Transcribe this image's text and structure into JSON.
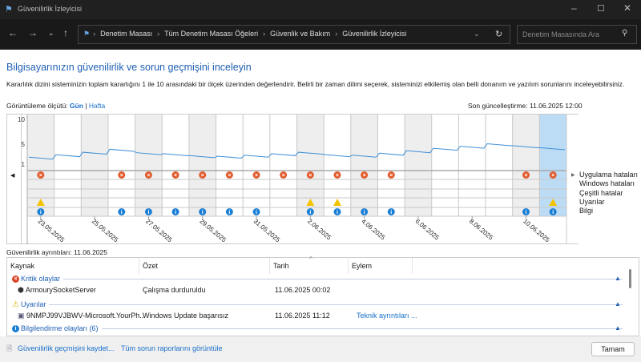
{
  "window": {
    "title": "Güvenilirlik İzleyicisi"
  },
  "address": {
    "crumbs": [
      "Denetim Masası",
      "Tüm Denetim Masası Öğeleri",
      "Güvenlik ve Bakım",
      "Güvenilirlik İzleyicisi"
    ],
    "search_placeholder": "Denetim Masasında Ara"
  },
  "main": {
    "heading": "Bilgisayarınızın güvenilirlik ve sorun geçmişini inceleyin",
    "description": "Kararlılık dizini sisteminizin toplam kararlığını 1 ile 10 arasındaki bir ölçek üzerinden değerlendirir. Belirli bir zaman dilimi seçerek, sisteminizi etkilemiş olan belli donanım ve yazılım sorunlarını inceleyebilirsiniz.",
    "view_label": "Görüntüleme ölçütü:",
    "view_day": "Gün",
    "view_sep": "|",
    "view_week": "Hafta",
    "last_updated": "Son güncelleştirme: 11.06.2025 12:00"
  },
  "chart_data": {
    "type": "line",
    "ylim": [
      1,
      10
    ],
    "yticks": [
      "10",
      "5",
      "1"
    ],
    "dates": [
      "23.05.2025",
      "24.05.2025",
      "25.05.2025",
      "26.05.2025",
      "27.05.2025",
      "28.05.2025",
      "29.05.2025",
      "30.05.2025",
      "31.05.2025",
      "1.06.2025",
      "2.06.2025",
      "3.06.2025",
      "4.06.2025",
      "5.06.2025",
      "6.06.2025",
      "7.06.2025",
      "8.06.2025",
      "9.06.2025",
      "10.06.2025",
      "11.06.2025"
    ],
    "date_labels": [
      "23.05.2025",
      "25.05.2025",
      "27.05.2025",
      "29.05.2025",
      "31.05.2025",
      "2.06.2025",
      "4.06.2025",
      "6.06.2025",
      "8.06.2025",
      "10.06.2025"
    ],
    "values": [
      2.0,
      2.5,
      3.0,
      3.6,
      2.9,
      2.7,
      2.3,
      2.2,
      2.4,
      2.7,
      3.0,
      2.5,
      2.4,
      2.8,
      3.3,
      3.8,
      4.2,
      4.7,
      4.3,
      3.9
    ],
    "selected_index": 19,
    "app_errors": [
      0,
      3,
      4,
      5,
      6,
      7,
      8,
      9,
      10,
      11,
      12,
      13,
      18,
      19
    ],
    "windows_errors": [],
    "misc_errors": [],
    "warnings": [
      0,
      10,
      11,
      19
    ],
    "info": [
      0,
      3,
      4,
      5,
      6,
      7,
      8,
      10,
      11,
      12,
      13,
      18,
      19
    ],
    "legend": [
      "Uygulama hataları",
      "Windows hataları",
      "Çeşitli hatalar",
      "Uyarılar",
      "Bilgi"
    ]
  },
  "details": {
    "title": "Güvenilirlik ayrıntıları: 11.06.2025",
    "columns": [
      "Kaynak",
      "Özet",
      "Tarih",
      "Eylem"
    ],
    "groups": [
      {
        "label": "Kritik olaylar",
        "rows": [
          {
            "source": "ArmourySocketServer",
            "summary": "Çalışma durduruldu",
            "date": "11.06.2025 00:02",
            "action": ""
          }
        ]
      },
      {
        "label": "Uyarılar",
        "rows": [
          {
            "source": "9NMPJ99VJBWV-Microsoft.YourPh...",
            "summary": "Windows Update başarısız",
            "date": "11.06.2025 11:12",
            "action": "Teknik ayrıntıları ..."
          }
        ]
      },
      {
        "label": "Bilgilendirme olayları (6)",
        "rows": []
      }
    ]
  },
  "footer": {
    "save": "Güvenilirlik geçmişini kaydet...",
    "all_reports": "Tüm sorun raporlarını görüntüle",
    "ok": "Tamam"
  }
}
